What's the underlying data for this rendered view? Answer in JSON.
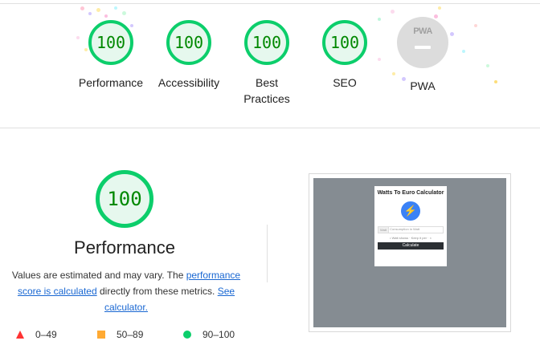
{
  "gauges": [
    {
      "label": "Performance",
      "score": "100"
    },
    {
      "label": "Accessibility",
      "score": "100"
    },
    {
      "label": "Best Practices",
      "score": "100"
    },
    {
      "label": "SEO",
      "score": "100"
    },
    {
      "label": "PWA",
      "badge": "PWA"
    }
  ],
  "performance": {
    "score": "100",
    "title": "Performance",
    "desc_prefix": "Values are estimated and may vary. The ",
    "link_score": "performance score is calculated",
    "desc_middle": " directly from these metrics. ",
    "link_calculator": "See calculator."
  },
  "legend": [
    {
      "range": "0–49",
      "color": "#ff3333",
      "icon": "red-triangle-icon"
    },
    {
      "range": "50–89",
      "color": "#ffaa33",
      "icon": "orange-square-icon"
    },
    {
      "range": "90–100",
      "color": "#0cce6b",
      "icon": "green-circle-icon"
    }
  ],
  "screenshot": {
    "title": "Watts To Euro Calculator",
    "input_unit": "Watt",
    "input_placeholder": "Consumption in Watt",
    "hint": "• Watt shows · Keep it per · ×",
    "button": "Calculate",
    "icon": "lightning-bolt-icon"
  },
  "colors": {
    "pass": "#0cce6b",
    "pass_text": "#008800",
    "average": "#ffaa33",
    "fail": "#ff3333",
    "link": "#1967d2"
  }
}
